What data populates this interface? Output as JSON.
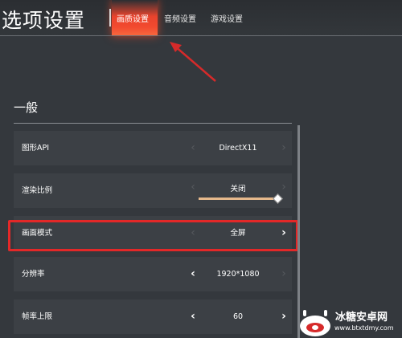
{
  "header": {
    "title": "选项设置",
    "tabs": [
      {
        "label": "画质设置",
        "active": true
      },
      {
        "label": "音频设置",
        "active": false
      },
      {
        "label": "游戏设置",
        "active": false
      }
    ]
  },
  "section": {
    "title": "一般"
  },
  "settings": [
    {
      "label": "图形API",
      "value": "DirectX11",
      "left_arrow": "dim",
      "right_arrow": "dim"
    },
    {
      "label": "渲染比例",
      "value": "关闭",
      "left_arrow": "dim",
      "right_arrow": "dim",
      "slider_level": 1.0
    },
    {
      "label": "画面模式",
      "value": "全屏",
      "left_arrow": "dim",
      "right_arrow": "bright",
      "highlighted": true
    },
    {
      "label": "分辨率",
      "value": "1920*1080",
      "left_arrow": "bright",
      "right_arrow": "dim"
    },
    {
      "label": "帧率上限",
      "value": "60",
      "left_arrow": "bright",
      "right_arrow": "bright"
    }
  ],
  "icons": {
    "prev": "chevron-left-icon",
    "next": "chevron-right-icon"
  },
  "colors": {
    "accent_tab": "#f24a2f",
    "highlight_box": "#e32828",
    "annotation_arrow": "#d62a2a",
    "slider": "#e6b98c"
  },
  "watermark": {
    "name": "冰糖安卓网",
    "url": "www.btxtdmy.com"
  }
}
